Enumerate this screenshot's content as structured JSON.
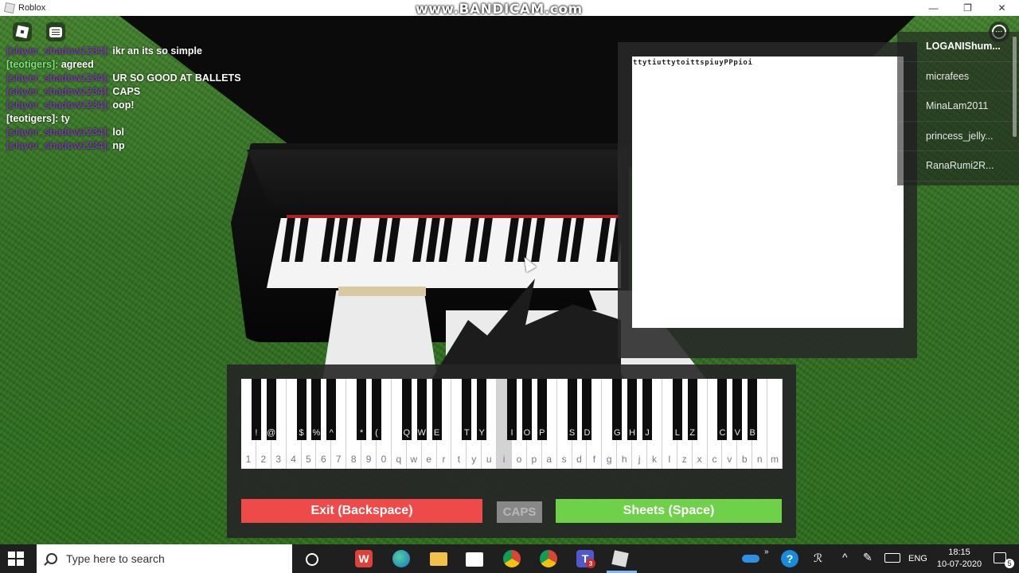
{
  "window": {
    "title": "Roblox",
    "watermark": "www.BANDICAM.com",
    "controls": {
      "minimize": "—",
      "maximize": "❐",
      "close": "✕"
    }
  },
  "chat": {
    "messages": [
      {
        "name": "[slayer_shadow1234]:",
        "text": "ikr an its so simple",
        "style": "purple"
      },
      {
        "name": "[teotigers]:",
        "text": "agreed",
        "style": "green"
      },
      {
        "name": "[slayer_shadow1234]:",
        "text": "UR SO GOOD AT BALLETS",
        "style": "purple"
      },
      {
        "name": "[slayer_shadow1234]:",
        "text": "CAPS",
        "style": "purple"
      },
      {
        "name": "[slayer_shadow1234]:",
        "text": "oop!",
        "style": "purple"
      },
      {
        "name": "[teotigers]:",
        "text": "ty",
        "style": "light"
      },
      {
        "name": "[slayer_shadow1234]:",
        "text": "lol",
        "style": "purple"
      },
      {
        "name": "[slayer_shadow1234]:",
        "text": "np",
        "style": "purple"
      }
    ]
  },
  "menu": {
    "icon": "more-options-icon",
    "glyph": "···"
  },
  "sheet": {
    "text": "ttytiuttytoittspiuyPPpioi"
  },
  "players": [
    "LOGANIShum...",
    "micrafees",
    "MinaLam2011",
    "princess_jelly...",
    "RanaRumi2R..."
  ],
  "keyboard": {
    "white_keys": [
      "1",
      "2",
      "3",
      "4",
      "5",
      "6",
      "7",
      "8",
      "9",
      "0",
      "q",
      "w",
      "e",
      "r",
      "t",
      "y",
      "u",
      "i",
      "o",
      "p",
      "a",
      "s",
      "d",
      "f",
      "g",
      "h",
      "j",
      "k",
      "l",
      "z",
      "x",
      "c",
      "v",
      "b",
      "n",
      "m"
    ],
    "pressed_white_index": 17,
    "black_keys": [
      {
        "after": 0,
        "label": "!"
      },
      {
        "after": 1,
        "label": "@"
      },
      {
        "after": 3,
        "label": "$"
      },
      {
        "after": 4,
        "label": "%"
      },
      {
        "after": 5,
        "label": "^"
      },
      {
        "after": 7,
        "label": "*"
      },
      {
        "after": 8,
        "label": "("
      },
      {
        "after": 10,
        "label": "Q"
      },
      {
        "after": 11,
        "label": "W"
      },
      {
        "after": 12,
        "label": "E"
      },
      {
        "after": 14,
        "label": "T"
      },
      {
        "after": 15,
        "label": "Y"
      },
      {
        "after": 17,
        "label": "I"
      },
      {
        "after": 18,
        "label": "O"
      },
      {
        "after": 19,
        "label": "P"
      },
      {
        "after": 21,
        "label": "S"
      },
      {
        "after": 22,
        "label": "D"
      },
      {
        "after": 24,
        "label": "G"
      },
      {
        "after": 25,
        "label": "H"
      },
      {
        "after": 26,
        "label": "J"
      },
      {
        "after": 28,
        "label": "L"
      },
      {
        "after": 29,
        "label": "Z"
      },
      {
        "after": 31,
        "label": "C"
      },
      {
        "after": 32,
        "label": "V"
      },
      {
        "after": 33,
        "label": "B"
      }
    ]
  },
  "buttons": {
    "exit": "Exit (Backspace)",
    "caps": "CAPS",
    "sheets": "Sheets (Space)"
  },
  "taskbar": {
    "search_placeholder": "Type here to search",
    "language": "ENG",
    "time": "18:15",
    "date": "10-07-2020",
    "notification_count": "5",
    "teams_badge": "3"
  },
  "colors": {
    "exit": "#ee4a4a",
    "sheets": "#6fd14a",
    "caps": "#888888",
    "chat_name": "#7a3ea8"
  }
}
